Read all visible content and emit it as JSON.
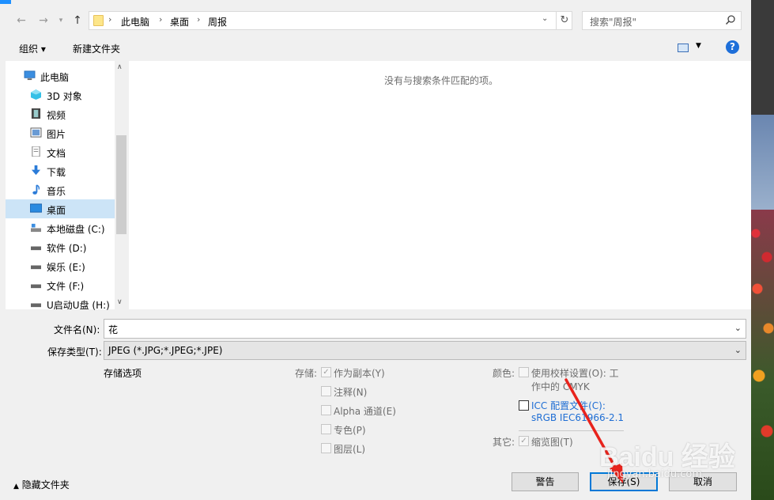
{
  "breadcrumb": [
    "此电脑",
    "桌面",
    "周报"
  ],
  "search": {
    "placeholder": "搜索\"周报\""
  },
  "toolbar": {
    "organize": "组织 ▾",
    "new_folder": "新建文件夹",
    "help": "?"
  },
  "nav": {
    "items": [
      {
        "label": "此电脑",
        "icon": "computer-icon"
      },
      {
        "label": "3D 对象",
        "icon": "3d-objects-icon"
      },
      {
        "label": "视频",
        "icon": "video-icon"
      },
      {
        "label": "图片",
        "icon": "pictures-icon"
      },
      {
        "label": "文档",
        "icon": "documents-icon"
      },
      {
        "label": "下载",
        "icon": "download-icon"
      },
      {
        "label": "音乐",
        "icon": "music-icon"
      },
      {
        "label": "桌面",
        "icon": "desktop-icon",
        "selected": true
      },
      {
        "label": "本地磁盘 (C:)",
        "icon": "drive-icon"
      },
      {
        "label": "软件 (D:)",
        "icon": "drive-icon"
      },
      {
        "label": "娱乐 (E:)",
        "icon": "drive-icon"
      },
      {
        "label": "文件 (F:)",
        "icon": "drive-icon"
      },
      {
        "label": "U启动U盘 (H:)",
        "icon": "usb-drive-icon"
      }
    ]
  },
  "filelist": {
    "empty_message": "没有与搜索条件匹配的项。"
  },
  "form": {
    "filename_label": "文件名(N):",
    "filename_value": "花",
    "filetype_label": "保存类型(T):",
    "filetype_value": "JPEG (*.JPG;*.JPEG;*.JPE)"
  },
  "options": {
    "section_title": "存储选项",
    "save_label": "存储:",
    "as_copy": "作为副本(Y)",
    "notes": "注释(N)",
    "alpha": "Alpha 通道(E)",
    "spot": "专色(P)",
    "layers": "图层(L)",
    "color_label": "颜色:",
    "proof_line1": "使用校样设置(O): 工",
    "proof_line2": "作中的 CMYK",
    "icc_line1": "ICC 配置文件(C):",
    "icc_line2": "sRGB IEC61966-2.1",
    "other_label": "其它:",
    "thumbnail": "缩览图(T)"
  },
  "buttons": {
    "warning": "警告",
    "save": "保存(S)",
    "cancel": "取消",
    "hide_folders": "隐藏文件夹"
  },
  "watermark": {
    "brand": "Baidu 经验",
    "url": "jingyan.baidu.com"
  },
  "colors": {
    "accent": "#0078d7",
    "annotation_arrow": "#e8231c",
    "selection": "#cce4f7"
  }
}
